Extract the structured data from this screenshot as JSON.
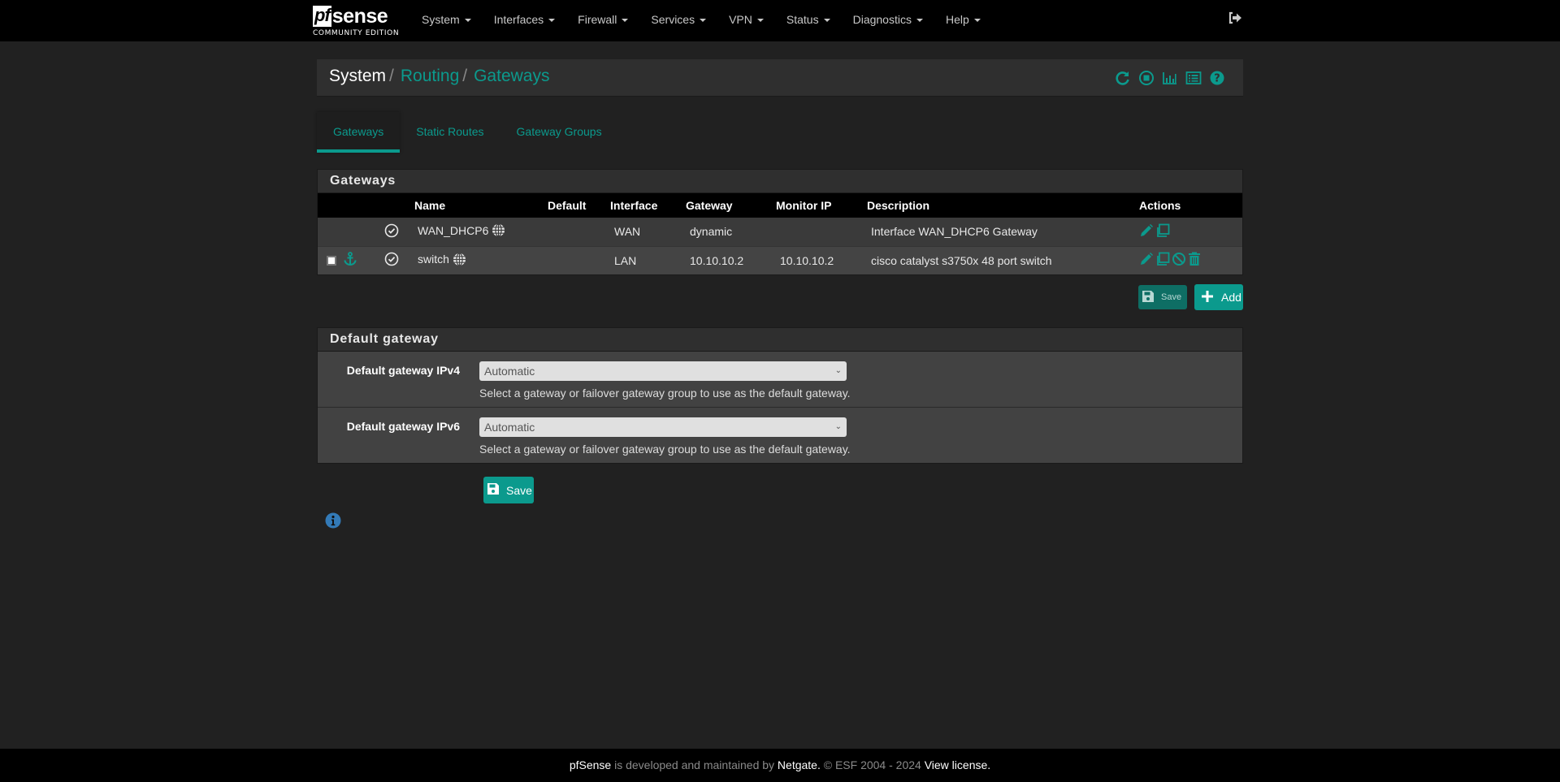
{
  "brand": {
    "logo_pf": "pf",
    "logo_sense": "sense",
    "edition": "COMMUNITY EDITION"
  },
  "nav": {
    "items": [
      "System",
      "Interfaces",
      "Firewall",
      "Services",
      "VPN",
      "Status",
      "Diagnostics",
      "Help"
    ]
  },
  "breadcrumb": {
    "items": [
      "System",
      "Routing",
      "Gateways"
    ],
    "separator": "/"
  },
  "header_icons": [
    "reload-icon",
    "stop-icon",
    "chart-icon",
    "log-list-icon",
    "help-icon"
  ],
  "tabs": [
    {
      "label": "Gateways",
      "active": true
    },
    {
      "label": "Static Routes",
      "active": false
    },
    {
      "label": "Gateway Groups",
      "active": false
    }
  ],
  "gateways_panel": {
    "title": "Gateways",
    "columns": [
      "",
      "",
      "Name",
      "Default",
      "Interface",
      "Gateway",
      "Monitor IP",
      "Description",
      "Actions"
    ],
    "rows": [
      {
        "checkbox": false,
        "anchor": false,
        "enabled": true,
        "name": "WAN_DHCP6",
        "default": "",
        "interface": "WAN",
        "gateway": "dynamic",
        "monitor_ip": "",
        "description": "Interface WAN_DHCP6 Gateway",
        "actions": [
          "edit",
          "copy"
        ]
      },
      {
        "checkbox": true,
        "anchor": true,
        "enabled": true,
        "name": "switch",
        "default": "",
        "interface": "LAN",
        "gateway": "10.10.10.2",
        "monitor_ip": "10.10.10.2",
        "description": "cisco catalyst s3750x 48 port switch",
        "actions": [
          "edit",
          "copy",
          "disable",
          "delete"
        ]
      }
    ],
    "save_label": "Save",
    "add_label": "Add"
  },
  "default_gateway_panel": {
    "title": "Default gateway",
    "fields": [
      {
        "label": "Default gateway IPv4",
        "value": "Automatic",
        "help": "Select a gateway or failover gateway group to use as the default gateway."
      },
      {
        "label": "Default gateway IPv6",
        "value": "Automatic",
        "help": "Select a gateway or failover gateway group to use as the default gateway."
      }
    ],
    "save_label": "Save"
  },
  "footer": {
    "brand": "pfSense",
    "text1": " is developed and maintained by ",
    "company": "Netgate.",
    "text2": " © ESF 2004 - 2024 ",
    "license": "View license."
  },
  "colors": {
    "accent": "#0b9a8d",
    "navbar_bg": "#000000",
    "page_bg": "#212121",
    "panel_bg": "#424242",
    "info": "#337ab7"
  }
}
